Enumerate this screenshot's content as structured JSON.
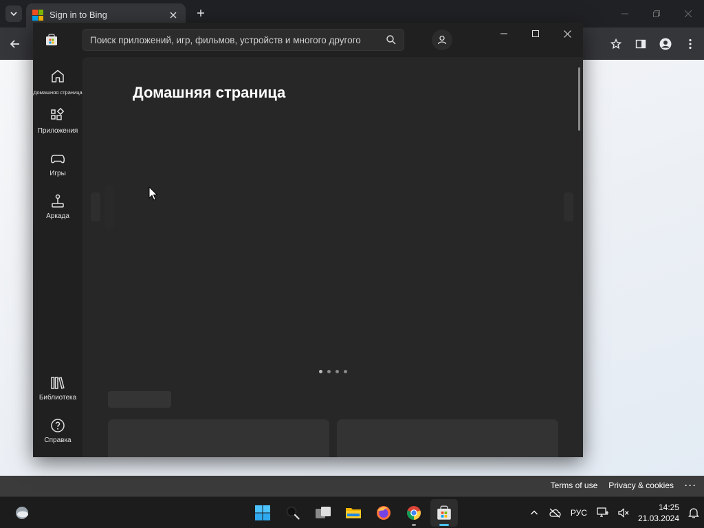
{
  "browser": {
    "tab": {
      "title": "Sign in to Bing"
    },
    "footer": {
      "terms": "Terms of use",
      "privacy": "Privacy & cookies",
      "more": "···"
    }
  },
  "store": {
    "search": {
      "placeholder": "Поиск приложений, игр, фильмов, устройств и многого другого"
    },
    "nav": {
      "home": "Домашняя страница",
      "apps": "Приложения",
      "games": "Игры",
      "arcade": "Аркада",
      "library": "Библиотека",
      "help": "Справка"
    },
    "page_title": "Домашняя страница",
    "carousel": {
      "count": 4,
      "active_index": 0
    }
  },
  "taskbar": {
    "language": "РУС",
    "time": "14:25",
    "date": "21.03.2024"
  },
  "colors": {
    "accent": "#4cc2ff",
    "store_bg": "#202020",
    "store_main_bg": "#272727",
    "taskbar_bg": "#1c1c1c"
  }
}
